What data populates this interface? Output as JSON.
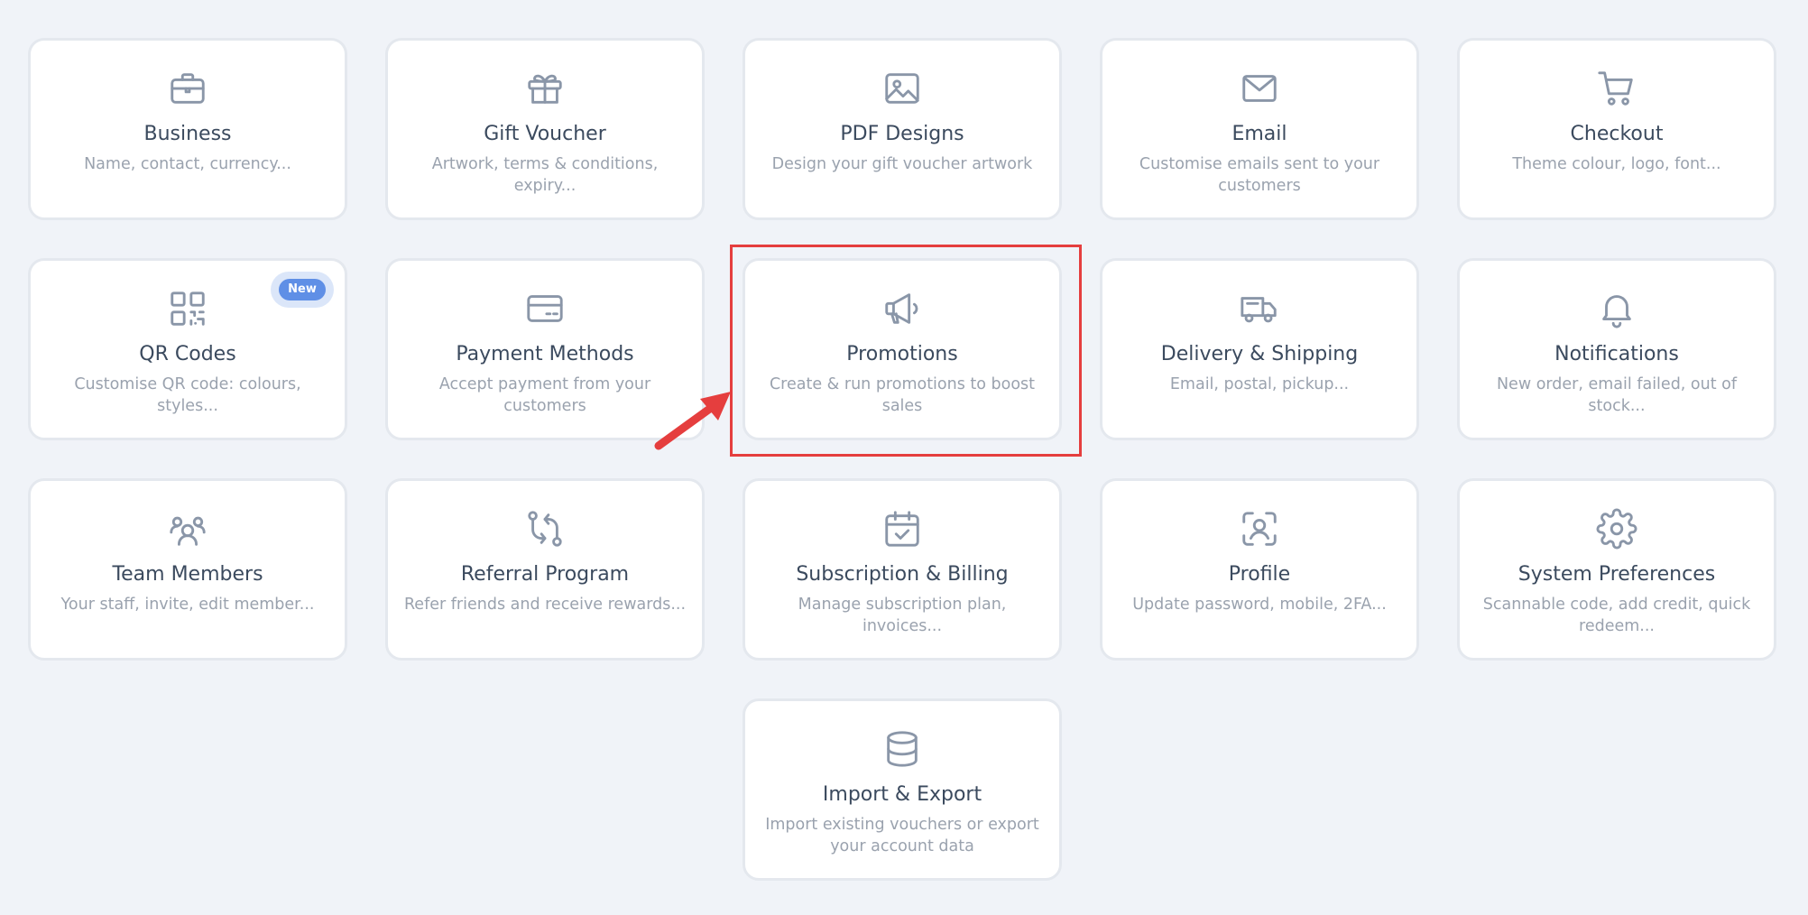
{
  "colors": {
    "background": "#f0f3f8",
    "card": "#ffffff",
    "icon": "#8a96a8",
    "title": "#3b4a5e",
    "description": "#9aa2ae",
    "badge": "#5f8fe6",
    "highlight": "#e53e3e"
  },
  "badge": {
    "label": "New"
  },
  "cards": [
    {
      "icon": "briefcase-icon",
      "title": "Business",
      "description": "Name, contact, currency..."
    },
    {
      "icon": "gift-icon",
      "title": "Gift Voucher",
      "description": "Artwork, terms & conditions, expiry..."
    },
    {
      "icon": "image-icon",
      "title": "PDF Designs",
      "description": "Design your gift voucher artwork"
    },
    {
      "icon": "mail-icon",
      "title": "Email",
      "description": "Customise emails sent to your customers"
    },
    {
      "icon": "cart-icon",
      "title": "Checkout",
      "description": "Theme colour, logo, font..."
    },
    {
      "icon": "qr-code-icon",
      "title": "QR Codes",
      "description": "Customise QR code: colours, styles..."
    },
    {
      "icon": "credit-card-icon",
      "title": "Payment Methods",
      "description": "Accept payment from your customers"
    },
    {
      "icon": "megaphone-icon",
      "title": "Promotions",
      "description": "Create & run promotions to boost sales"
    },
    {
      "icon": "truck-icon",
      "title": "Delivery & Shipping",
      "description": "Email, postal, pickup..."
    },
    {
      "icon": "bell-icon",
      "title": "Notifications",
      "description": "New order, email failed, out of stock..."
    },
    {
      "icon": "users-icon",
      "title": "Team Members",
      "description": "Your staff, invite, edit member..."
    },
    {
      "icon": "referral-arrows-icon",
      "title": "Referral Program",
      "description": "Refer friends and receive rewards..."
    },
    {
      "icon": "calendar-check-icon",
      "title": "Subscription & Billing",
      "description": "Manage subscription plan, invoices..."
    },
    {
      "icon": "user-scan-icon",
      "title": "Profile",
      "description": "Update password, mobile, 2FA..."
    },
    {
      "icon": "gear-icon",
      "title": "System Preferences",
      "description": "Scannable code, add credit, quick redeem..."
    },
    {
      "icon": "database-icon",
      "title": "Import & Export",
      "description": "Import existing vouchers or export your account data"
    }
  ]
}
